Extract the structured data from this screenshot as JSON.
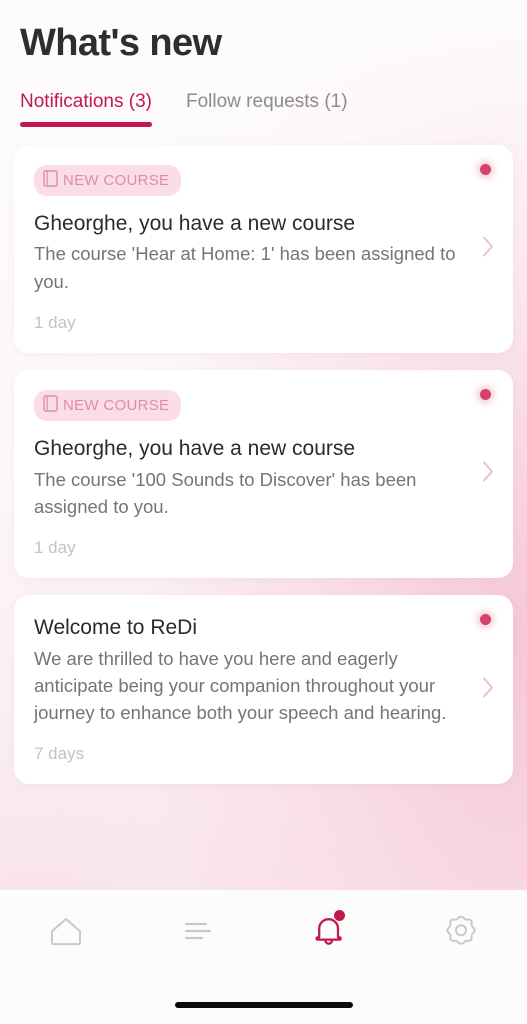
{
  "header": {
    "title": "What's new"
  },
  "tabs": [
    {
      "label": "Notifications (3)",
      "active": true
    },
    {
      "label": "Follow requests (1)",
      "active": false
    }
  ],
  "notifications": [
    {
      "badge": "NEW COURSE",
      "badge_icon": "book-icon",
      "title": "Gheorghe, you have a new course",
      "body": "The course 'Hear at Home: 1' has been assigned to you.",
      "time": "1 day",
      "unread": true
    },
    {
      "badge": "NEW COURSE",
      "badge_icon": "book-icon",
      "title": "Gheorghe, you have a new course",
      "body": "The course '100 Sounds to Discover' has been assigned to you.",
      "time": "1 day",
      "unread": true
    },
    {
      "badge": null,
      "badge_icon": null,
      "title": "Welcome to ReDi",
      "body": "We are thrilled to have you here and eagerly anticipate being your companion throughout your journey to enhance both your speech and hearing.",
      "time": "7 days",
      "unread": true
    }
  ],
  "bottom_nav": [
    {
      "icon": "home-icon",
      "active": false,
      "badge": false
    },
    {
      "icon": "list-icon",
      "active": false,
      "badge": false
    },
    {
      "icon": "bell-icon",
      "active": true,
      "badge": true
    },
    {
      "icon": "gear-icon",
      "active": false,
      "badge": false
    }
  ],
  "colors": {
    "accent": "#c2184a",
    "badge_bg": "#fadde5",
    "badge_text": "#e08ca4",
    "unread_dot": "#d4426b",
    "inactive_icon": "#c9c9cd",
    "chevron": "#f0bdcd"
  }
}
